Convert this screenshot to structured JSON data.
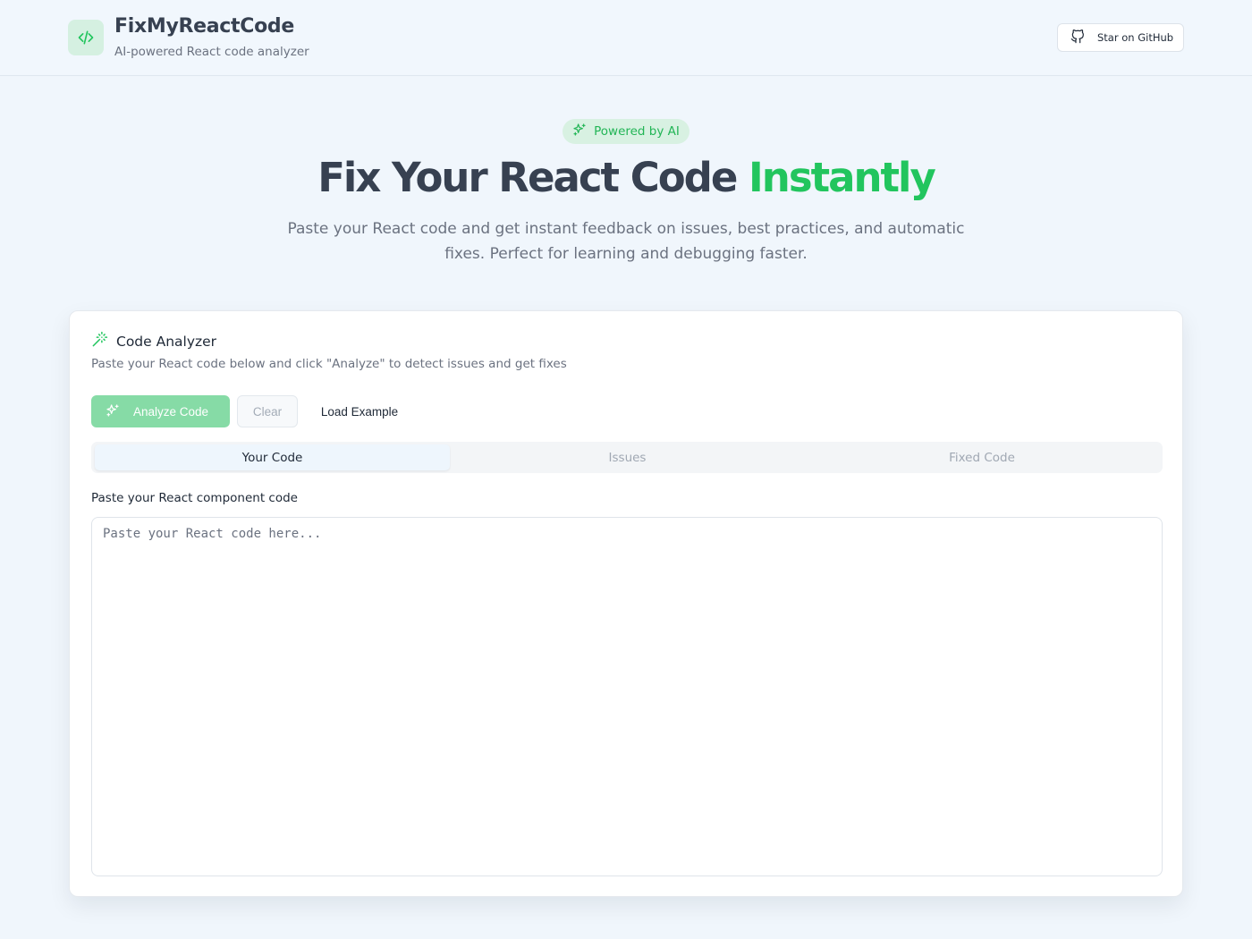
{
  "colors": {
    "accent": "#22c55e",
    "accent_soft": "#d8f1e2",
    "background": "#f0f6fc",
    "text_primary": "#374151",
    "text_secondary": "#6b7280"
  },
  "header": {
    "title": "FixMyReactCode",
    "subtitle": "AI-powered React code analyzer",
    "logo_icon": "code-icon",
    "github_button": {
      "label": "Star on GitHub",
      "icon": "github-icon"
    }
  },
  "hero": {
    "badge": {
      "label": "Powered by AI",
      "icon": "sparkles-icon"
    },
    "title_main": "Fix Your React Code",
    "title_accent": "Instantly",
    "description_line1": "Paste your React code and get instant feedback on issues, best practices, and automatic",
    "description_line2": "fixes. Perfect for learning and debugging faster."
  },
  "analyzer": {
    "title": "Code Analyzer",
    "title_icon": "magic-wand-icon",
    "subtitle": "Paste your React code below and click \"Analyze\" to detect issues and get fixes",
    "buttons": {
      "analyze": "Analyze Code",
      "analyze_icon": "sparkles-icon",
      "clear": "Clear",
      "load_example": "Load Example"
    },
    "tabs": [
      {
        "label": "Your Code",
        "active": true
      },
      {
        "label": "Issues",
        "active": false
      },
      {
        "label": "Fixed Code",
        "active": false
      }
    ],
    "input": {
      "label": "Paste your React component code",
      "value": "",
      "placeholder": "Paste your React code here..."
    }
  }
}
